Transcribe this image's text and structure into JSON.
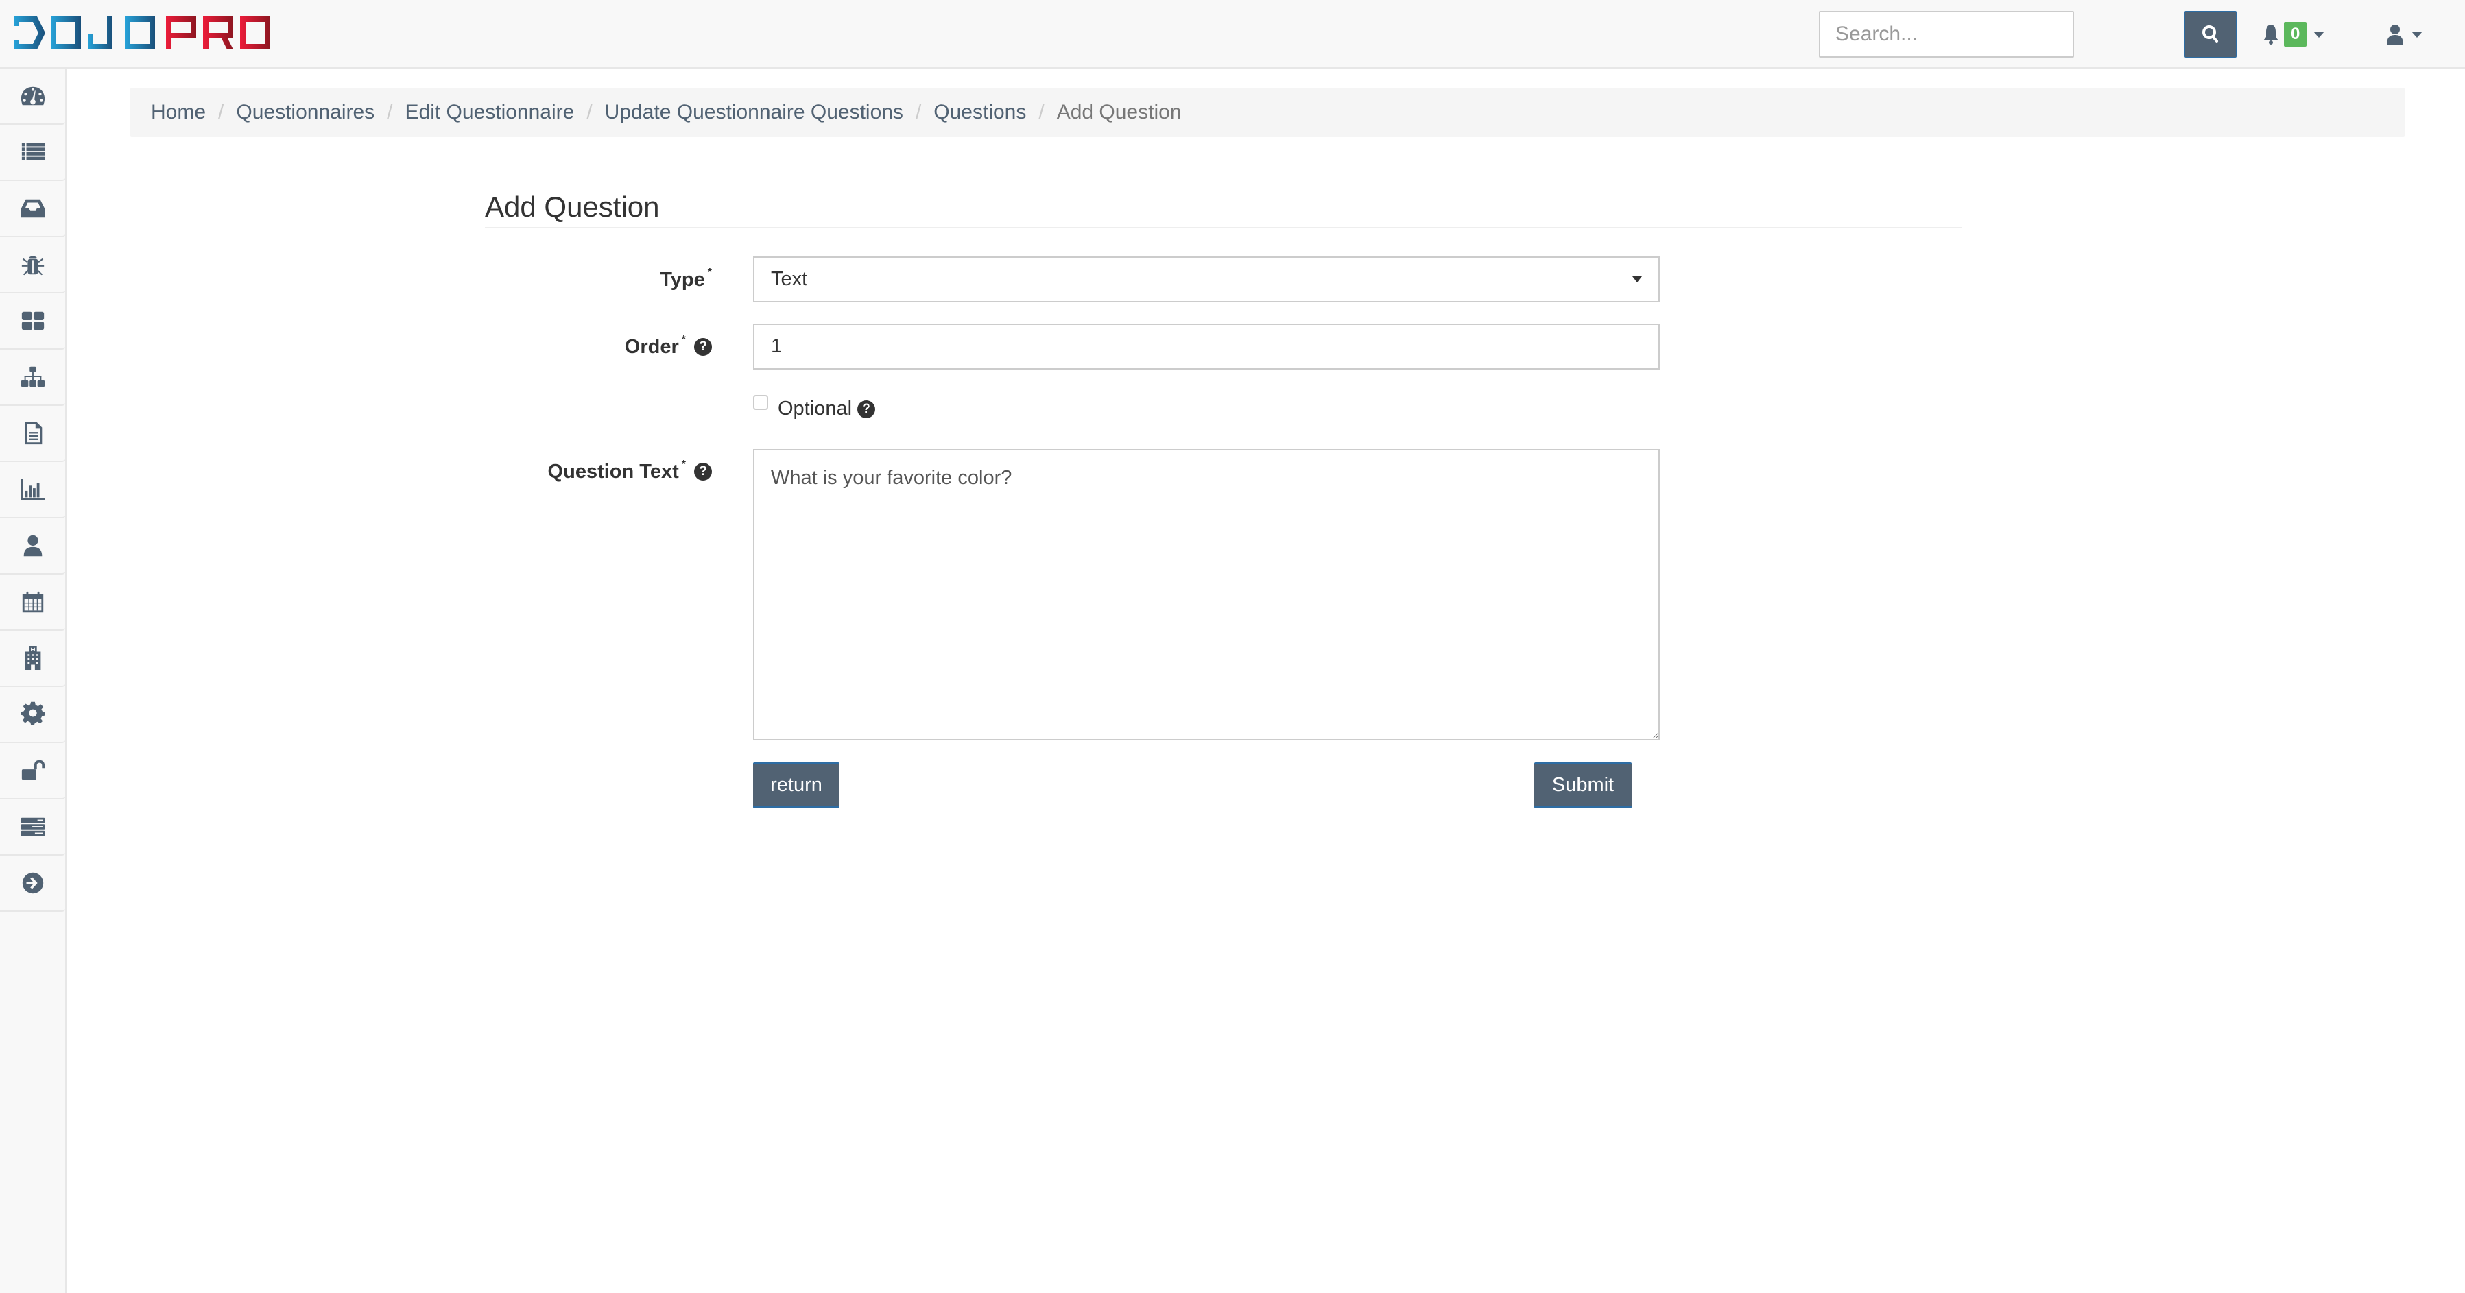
{
  "header": {
    "logo_text_left": "DOJO",
    "logo_text_right": "PRO",
    "search": {
      "placeholder": "Search...",
      "value": ""
    },
    "search_button_icon": "search-icon",
    "notifications": {
      "icon": "bell-icon",
      "count": "0"
    },
    "user_menu_icon": "user-icon"
  },
  "sidebar": {
    "items": [
      {
        "icon": "dashboard-icon"
      },
      {
        "icon": "list-icon"
      },
      {
        "icon": "inbox-icon"
      },
      {
        "icon": "bug-icon"
      },
      {
        "icon": "grid-icon"
      },
      {
        "icon": "sitemap-icon"
      },
      {
        "icon": "file-text-icon"
      },
      {
        "icon": "bar-chart-icon"
      },
      {
        "icon": "user-icon"
      },
      {
        "icon": "calendar-icon"
      },
      {
        "icon": "hospital-icon"
      },
      {
        "icon": "gear-icon"
      },
      {
        "icon": "unlock-icon"
      },
      {
        "icon": "server-icon"
      },
      {
        "icon": "arrow-circle-right-icon"
      }
    ]
  },
  "breadcrumb": [
    {
      "label": "Home"
    },
    {
      "label": "Questionnaires"
    },
    {
      "label": "Edit Questionnaire"
    },
    {
      "label": "Update Questionnaire Questions"
    },
    {
      "label": "Questions"
    },
    {
      "label": "Add Question"
    }
  ],
  "breadcrumb_separator": "/",
  "page": {
    "title": "Add Question",
    "form": {
      "type": {
        "label": "Type",
        "required_mark": "*",
        "value": "Text"
      },
      "order": {
        "label": "Order",
        "required_mark": "*",
        "value": "1",
        "help": "?"
      },
      "optional": {
        "label": "Optional",
        "checked": false,
        "help": "?"
      },
      "question_text": {
        "label": "Question Text",
        "required_mark": "*",
        "value": "What is your favorite color?",
        "help": "?"
      }
    },
    "buttons": {
      "return_label": "return",
      "submit_label": "Submit"
    }
  },
  "colors": {
    "primary": "#516273",
    "badge_green": "#5cb85c",
    "logo_blue": "#1f8fc4",
    "logo_red": "#e0193a"
  }
}
